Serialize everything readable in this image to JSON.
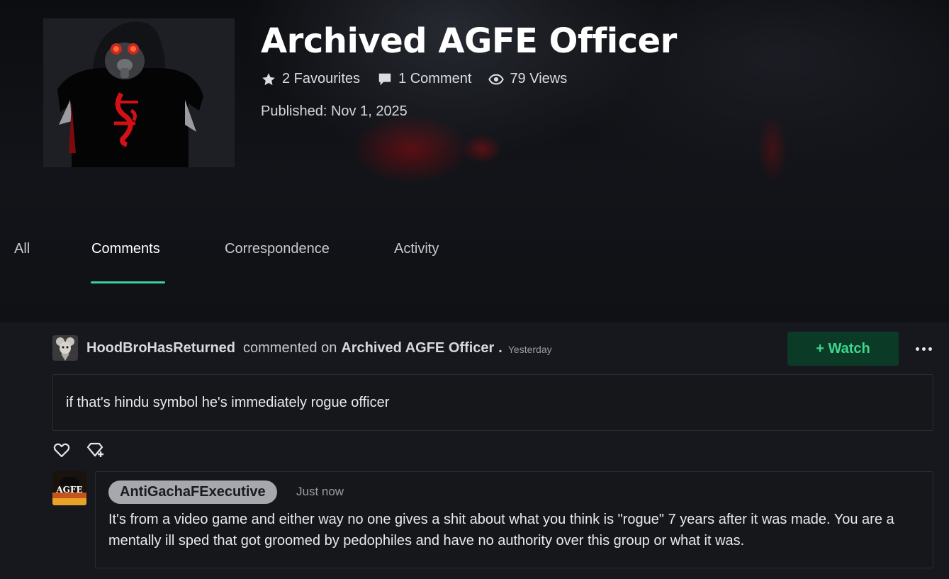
{
  "artwork": {
    "title": "Archived AGFE Officer",
    "thumbnail_icon": "hooded-gas-mask-figure-image",
    "stats": {
      "favourites": "2 Favourites",
      "comments": "1 Comment",
      "views": "79 Views"
    },
    "published": "Published: Nov 1, 2025"
  },
  "tabs": [
    {
      "label": "All",
      "active": false
    },
    {
      "label": "Comments",
      "active": true
    },
    {
      "label": "Correspondence",
      "active": false
    },
    {
      "label": "Activity",
      "active": false
    }
  ],
  "accent_color": "#3fd0a1",
  "comment": {
    "author": "HoodBroHasReturned",
    "action": "commented on",
    "target": "Archived AGFE Officer",
    "separator": ".",
    "timestamp": "Yesterday",
    "body": "if that's hindu symbol he's immediately rogue officer",
    "watch_label": "+ Watch",
    "avatar_icon": "rat-avatar-image"
  },
  "reply": {
    "author": "AntiGachaFExecutive",
    "timestamp": "Just now",
    "body": "It's from a video game and either way no one gives a shit about what you think is \"rogue\" 7 years after it was made. You are a mentally ill sped that got groomed by pedophiles and have no authority over this group or what it was.",
    "avatar_icon": "agfe-logo-avatar-image",
    "avatar_text": "AGFE"
  }
}
